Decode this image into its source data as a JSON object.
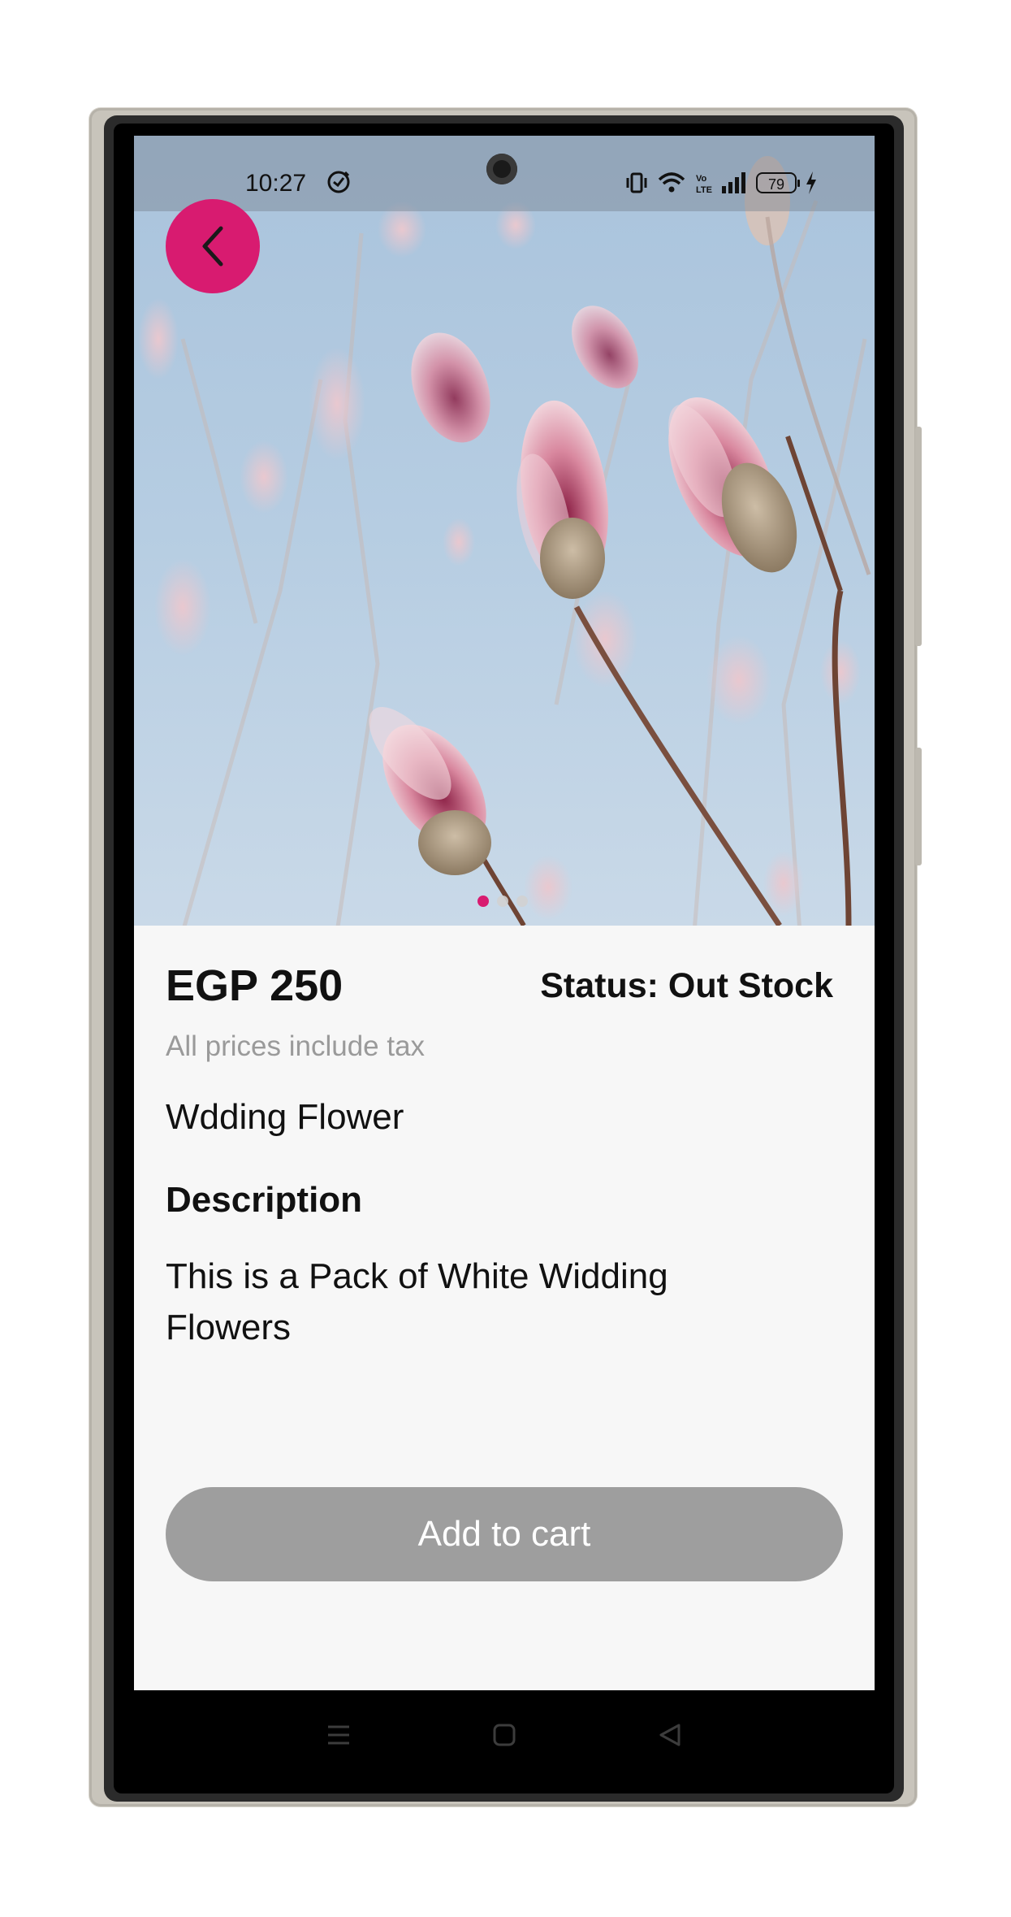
{
  "status_bar": {
    "time": "10:27",
    "battery": "79",
    "icons": [
      "sync-icon",
      "vibrate-icon",
      "wifi-icon",
      "volte-icon",
      "signal-icon",
      "battery-icon",
      "charging-icon"
    ]
  },
  "gallery": {
    "image": "pink-magnolia-buds-photo",
    "page_count": 3,
    "active_index": 0,
    "accent_color": "#d81b70"
  },
  "product": {
    "price": "EGP 250",
    "status": "Status: Out Stock",
    "tax_note": "All prices include tax",
    "name": "Wdding Flower",
    "description_heading": "Description",
    "description": "This is a Pack of White Widding Flowers"
  },
  "actions": {
    "add_to_cart": "Add to cart",
    "add_to_cart_color": "#9e9e9e"
  },
  "navigation": {
    "back_icon": "chevron-left-icon",
    "system_buttons": [
      "recents-icon",
      "home-icon",
      "back-triangle-icon"
    ]
  }
}
